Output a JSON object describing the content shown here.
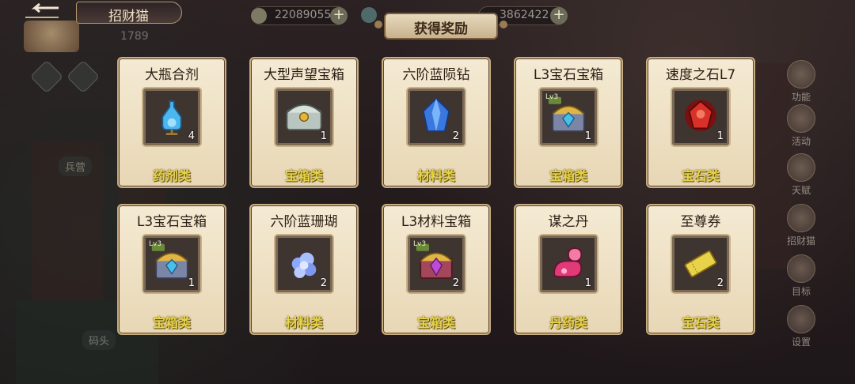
{
  "header": {
    "title": "招财猫",
    "gold_value": "22089055",
    "gem_value": "3862422",
    "faded_number": "1789",
    "plus_label": "+"
  },
  "banner": {
    "title": "获得奖励"
  },
  "left_labels": {
    "barracks": "兵营",
    "dock": "码头"
  },
  "side_menu": [
    {
      "label": "功能"
    },
    {
      "label": "活动"
    },
    {
      "label": "天赋"
    },
    {
      "label": "招财猫"
    },
    {
      "label": "目标"
    },
    {
      "label": "设置"
    }
  ],
  "rewards": [
    {
      "name": "大瓶合剂",
      "count": "4",
      "category": "药剂类",
      "icon": "potion-bottle-icon"
    },
    {
      "name": "大型声望宝箱",
      "count": "1",
      "category": "宝箱类",
      "icon": "silver-chest-icon"
    },
    {
      "name": "六阶蓝陨钻",
      "count": "2",
      "category": "材料类",
      "icon": "blue-crystal-icon"
    },
    {
      "name": "L3宝石宝箱",
      "count": "1",
      "category": "宝箱类",
      "icon": "gem-chest-icon"
    },
    {
      "name": "速度之石L7",
      "count": "1",
      "category": "宝石类",
      "icon": "red-gem-icon"
    },
    {
      "name": "L3宝石宝箱",
      "count": "1",
      "category": "宝箱类",
      "icon": "gem-chest-icon"
    },
    {
      "name": "六阶蓝珊瑚",
      "count": "2",
      "category": "材料类",
      "icon": "blue-coral-icon"
    },
    {
      "name": "L3材料宝箱",
      "count": "2",
      "category": "宝箱类",
      "icon": "material-chest-icon"
    },
    {
      "name": "谋之丹",
      "count": "1",
      "category": "丹药类",
      "icon": "pink-pill-icon"
    },
    {
      "name": "至尊券",
      "count": "2",
      "category": "宝石类",
      "icon": "gold-ticket-icon"
    }
  ],
  "chest_level_tag": "Lv3"
}
